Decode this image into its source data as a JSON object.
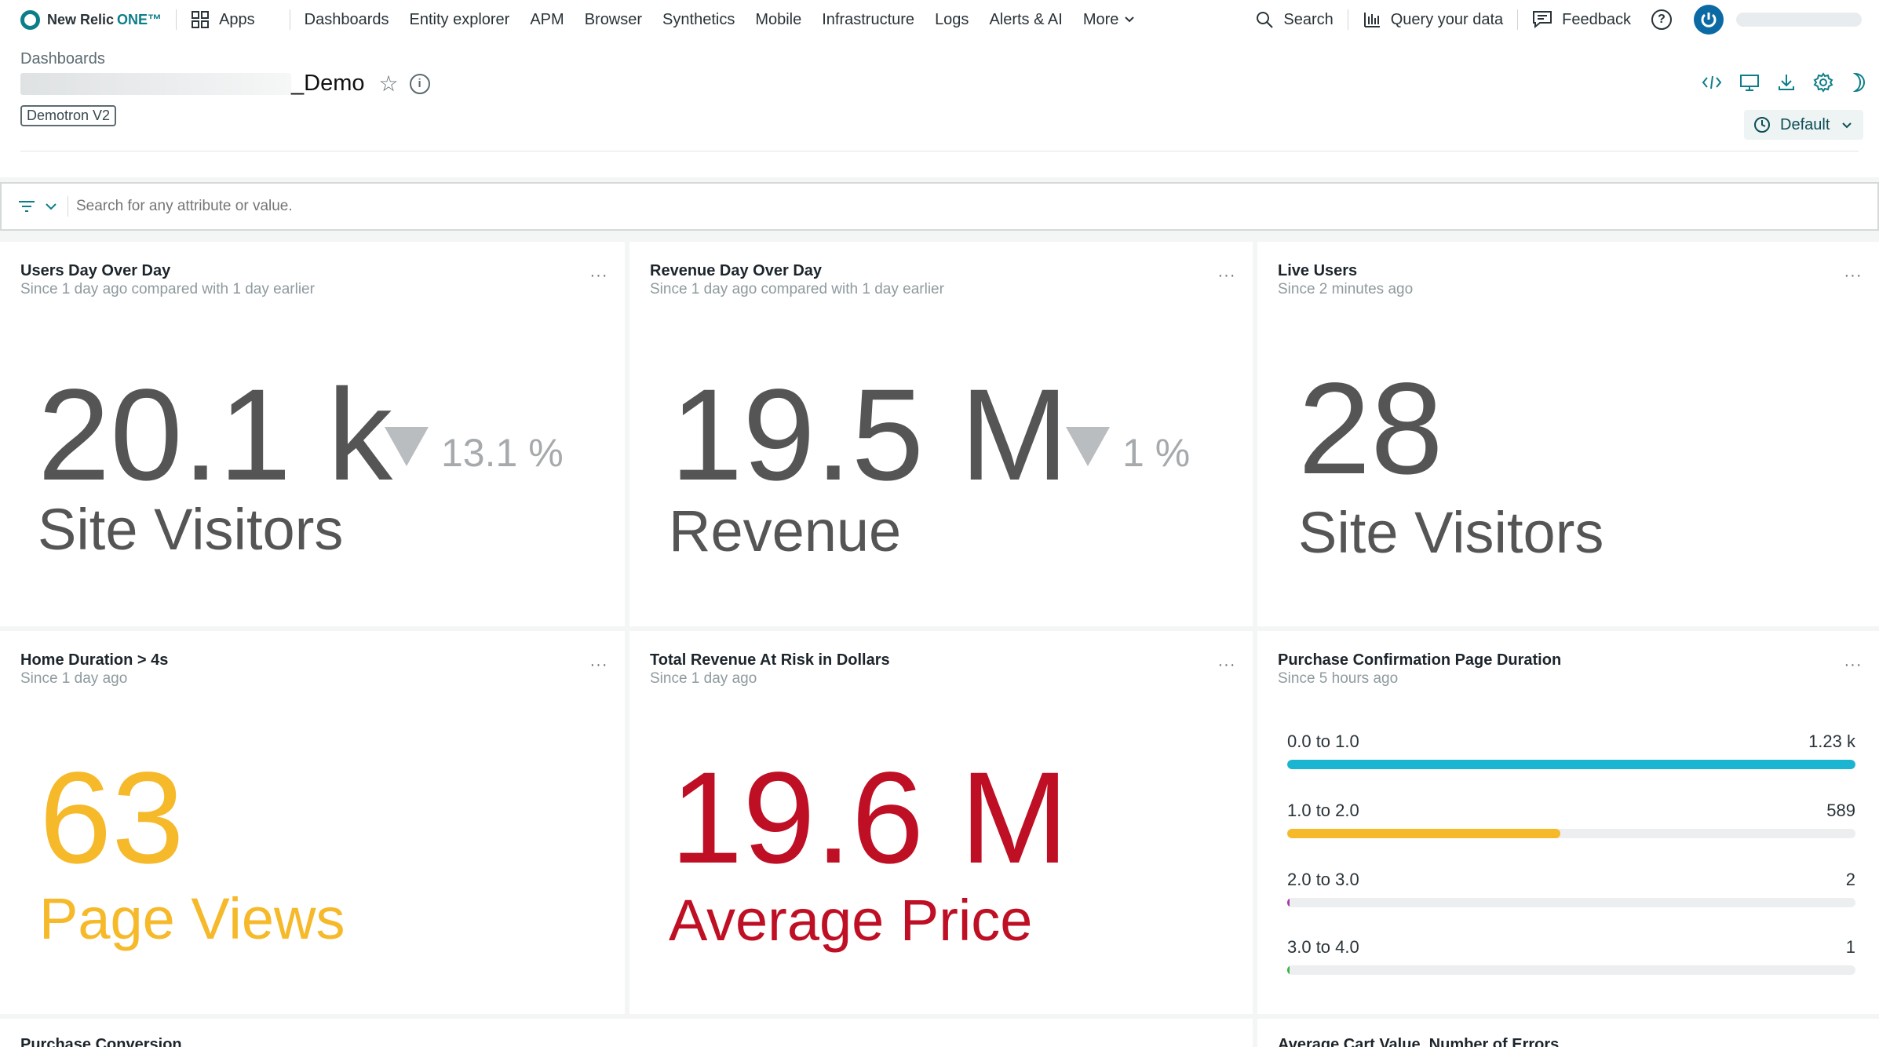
{
  "nav": {
    "brand_text": "New Relic",
    "brand_suffix": "ONE™",
    "apps": "Apps",
    "items": [
      "Dashboards",
      "Entity explorer",
      "APM",
      "Browser",
      "Synthetics",
      "Mobile",
      "Infrastructure",
      "Logs",
      "Alerts & AI"
    ],
    "more": "More",
    "search": "Search",
    "query": "Query your data",
    "feedback": "Feedback",
    "help": "?"
  },
  "header": {
    "breadcrumb": "Dashboards",
    "title_suffix": "_Demo",
    "tag": "Demotron V2",
    "time_picker": "Default"
  },
  "filter": {
    "placeholder": "Search for any attribute or value."
  },
  "widgets": {
    "users": {
      "title": "Users Day Over Day",
      "subtitle": "Since 1 day ago compared with 1 day earlier",
      "value": "20.1 k",
      "change": "13.1 %",
      "label": "Site Visitors"
    },
    "revenue": {
      "title": "Revenue Day Over Day",
      "subtitle": "Since 1 day ago compared with 1 day earlier",
      "value": "19.5 M",
      "change": "1 %",
      "label": "Revenue"
    },
    "live": {
      "title": "Live Users",
      "subtitle": "Since 2 minutes ago",
      "value": "28",
      "label": "Site Visitors"
    },
    "home": {
      "title": "Home Duration > 4s",
      "subtitle": "Since 1 day ago",
      "value": "63",
      "label": "Page Views",
      "color": "#f5b92a"
    },
    "risk": {
      "title": "Total Revenue At Risk in Dollars",
      "subtitle": "Since 1 day ago",
      "value": "19.6 M",
      "label": "Average Price",
      "color": "#bf0f24"
    },
    "purchase": {
      "title": "Purchase Confirmation Page Duration",
      "subtitle": "Since 5 hours ago",
      "rows": [
        {
          "label": "0.0 to 1.0",
          "value": "1.23 k",
          "fraction": 1.0,
          "color": "#1bb5d2"
        },
        {
          "label": "1.0 to 2.0",
          "value": "589",
          "fraction": 0.48,
          "color": "#f5b92a"
        },
        {
          "label": "2.0 to 3.0",
          "value": "2",
          "fraction": 0.003,
          "color": "#a23aa8"
        },
        {
          "label": "3.0 to 4.0",
          "value": "1",
          "fraction": 0.002,
          "color": "#3bb54a"
        }
      ]
    },
    "conversion": {
      "title": "Purchase Conversion"
    },
    "cart": {
      "title": "Average Cart Value, Number of Errors"
    }
  },
  "menu_glyph": "···"
}
